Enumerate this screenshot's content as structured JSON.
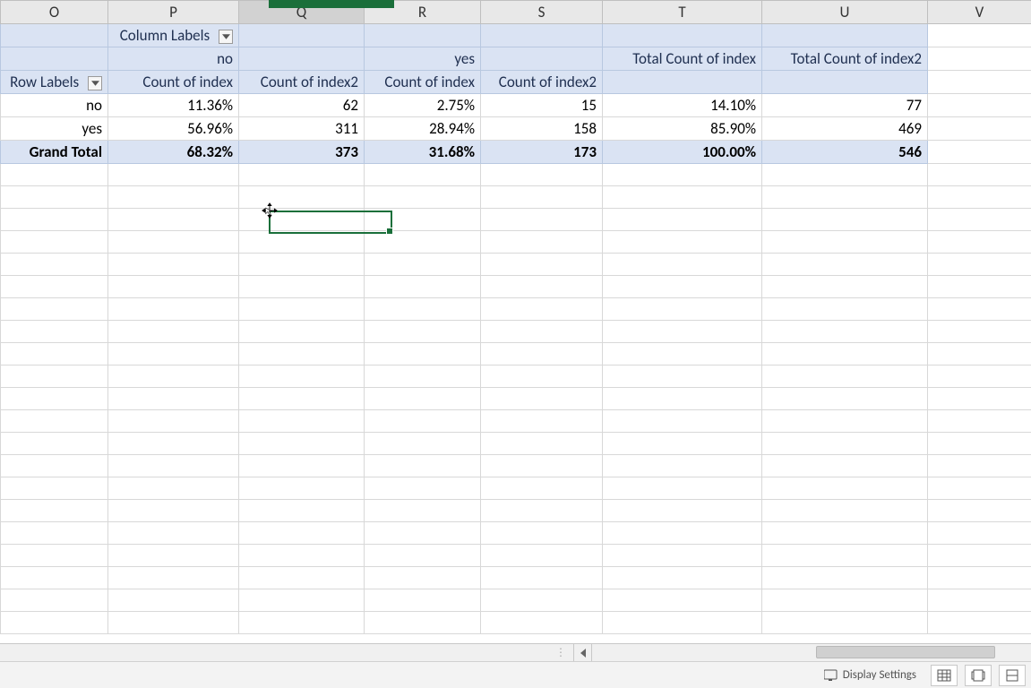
{
  "columns": [
    "O",
    "P",
    "Q",
    "R",
    "S",
    "T",
    "U",
    "V"
  ],
  "selected_column_index": 2,
  "pivot": {
    "column_labels_title": "Column Labels",
    "row_labels_title": "Row Labels",
    "col_groups": {
      "no": "no",
      "yes": "yes"
    },
    "measures": {
      "count_index": "Count of index",
      "count_index2": "Count of index2",
      "total_count_index": "Total Count of index",
      "total_count_index2": "Total Count of index2"
    },
    "rows": [
      {
        "label": "no",
        "no_ci": "11.36%",
        "no_ci2": "62",
        "yes_ci": "2.75%",
        "yes_ci2": "15",
        "tot_ci": "14.10%",
        "tot_ci2": "77"
      },
      {
        "label": "yes",
        "no_ci": "56.96%",
        "no_ci2": "311",
        "yes_ci": "28.94%",
        "yes_ci2": "158",
        "tot_ci": "85.90%",
        "tot_ci2": "469"
      }
    ],
    "grand_total": {
      "label": "Grand Total",
      "no_ci": "68.32%",
      "no_ci2": "373",
      "yes_ci": "31.68%",
      "yes_ci2": "173",
      "tot_ci": "100.00%",
      "tot_ci2": "546"
    }
  },
  "statusbar": {
    "display_settings": "Display Settings"
  },
  "chart_data": {
    "type": "table",
    "title": "Pivot table: Count of index / index2 by Row Labels × Column Labels",
    "column_groups": [
      "no",
      "yes"
    ],
    "row_labels": [
      "no",
      "yes",
      "Grand Total"
    ],
    "series": [
      {
        "name": "no · Count of index (%)",
        "values": [
          11.36,
          56.96,
          68.32
        ]
      },
      {
        "name": "no · Count of index2",
        "values": [
          62,
          311,
          373
        ]
      },
      {
        "name": "yes · Count of index (%)",
        "values": [
          2.75,
          28.94,
          31.68
        ]
      },
      {
        "name": "yes · Count of index2",
        "values": [
          15,
          158,
          173
        ]
      },
      {
        "name": "Total Count of index (%)",
        "values": [
          14.1,
          85.9,
          100.0
        ]
      },
      {
        "name": "Total Count of index2",
        "values": [
          77,
          469,
          546
        ]
      }
    ]
  }
}
